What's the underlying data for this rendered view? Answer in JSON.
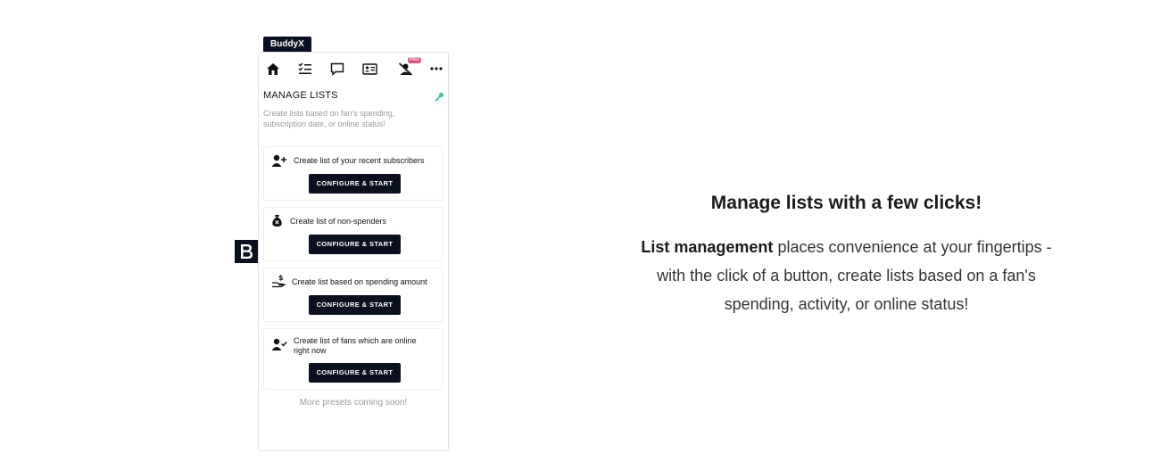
{
  "app": {
    "tag": "BuddyX"
  },
  "toolbar": {
    "icons": [
      "home-icon",
      "checklist-icon",
      "chat-icon",
      "id-card-icon",
      "user-off-icon",
      "more-icon"
    ],
    "pro_badge": "PRO"
  },
  "panel": {
    "title": "MANAGE LISTS",
    "subtitle": "Create lists based on fan's spending, subscription date, or online status!",
    "cards": [
      {
        "icon": "user-plus-icon",
        "label": "Create list of your recent subscribers",
        "button": "CONFIGURE & START"
      },
      {
        "icon": "money-bag-icon",
        "label": "Create list of non-spenders",
        "button": "CONFIGURE & START"
      },
      {
        "icon": "hand-dollar-icon",
        "label": "Create list based on spending amount",
        "button": "CONFIGURE & START"
      },
      {
        "icon": "user-check-icon",
        "label": "Create list of fans which are online right now",
        "button": "CONFIGURE & START"
      }
    ],
    "footer": "More presets coming soon!"
  },
  "logo": {
    "letter": "B"
  },
  "feature": {
    "headline": "Manage lists with a few clicks!",
    "emphasis": "List management",
    "body": " places convenience at your fingertips - with the click of a button, create lists based on a fan's spending, activity, or online status!"
  },
  "colors": {
    "primary": "#0b1021",
    "accent": "#e6477d",
    "key": "#3cc2a5"
  }
}
